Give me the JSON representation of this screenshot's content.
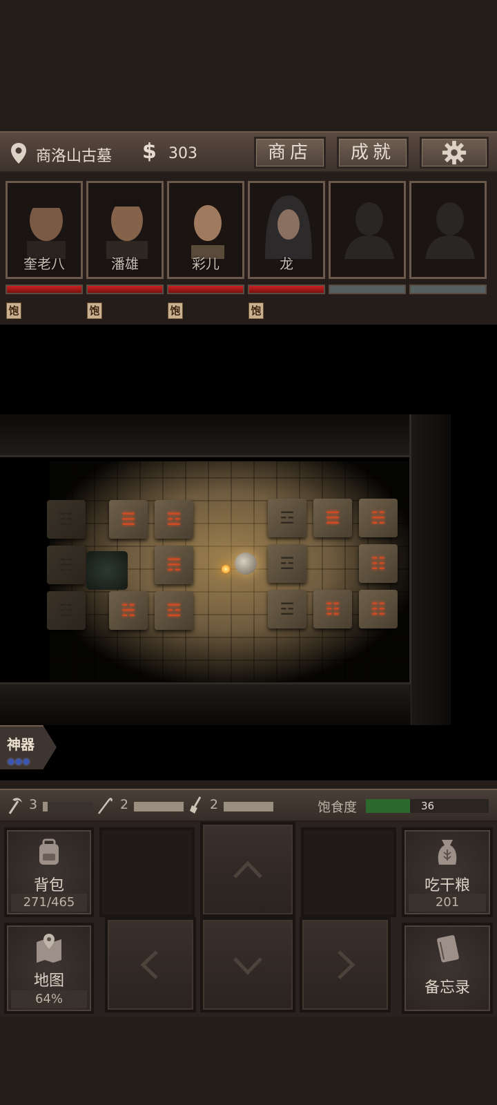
{
  "header": {
    "location_icon": "map-pin-icon",
    "location_name": "商洛山古墓",
    "currency_symbol": "$",
    "money": "303",
    "shop_label": "商店",
    "achievements_label": "成就",
    "settings_icon": "gear-icon"
  },
  "party": [
    {
      "name": "奎老八",
      "hp": 1.0,
      "status": "饱"
    },
    {
      "name": "潘雄",
      "hp": 1.0,
      "status": "饱"
    },
    {
      "name": "彩儿",
      "hp": 1.0,
      "status": "饱"
    },
    {
      "name": "龙",
      "hp": 1.0,
      "status": "饱"
    },
    {
      "name": "",
      "hp": 0,
      "status": ""
    },
    {
      "name": "",
      "hp": 0,
      "status": ""
    }
  ],
  "artifact": {
    "label": "神器",
    "charges": 3
  },
  "tools": [
    {
      "icon": "pickaxe-icon",
      "count": "3",
      "level": 0.1
    },
    {
      "icon": "hook-icon",
      "count": "2",
      "level": 1.0
    },
    {
      "icon": "shovel-icon",
      "count": "2",
      "level": 1.0
    }
  ],
  "satiety": {
    "label": "饱食度",
    "value": "36",
    "level": 0.36
  },
  "controls": {
    "backpack_label": "背包",
    "backpack_value": "271/465",
    "ration_label": "吃干粮",
    "ration_value": "201",
    "map_label": "地图",
    "map_value": "64%",
    "memo_label": "备忘录"
  },
  "trigram_glyphs": {
    "qian": "☰",
    "kun": "☷",
    "kan": "☵",
    "li": "☲",
    "zhen": "☳",
    "xun": "☴",
    "gen": "☶",
    "dui": "☱"
  },
  "colors": {
    "hp": "#c22222",
    "satiety": "#2b6a2c",
    "trigram": "#d04a22"
  }
}
